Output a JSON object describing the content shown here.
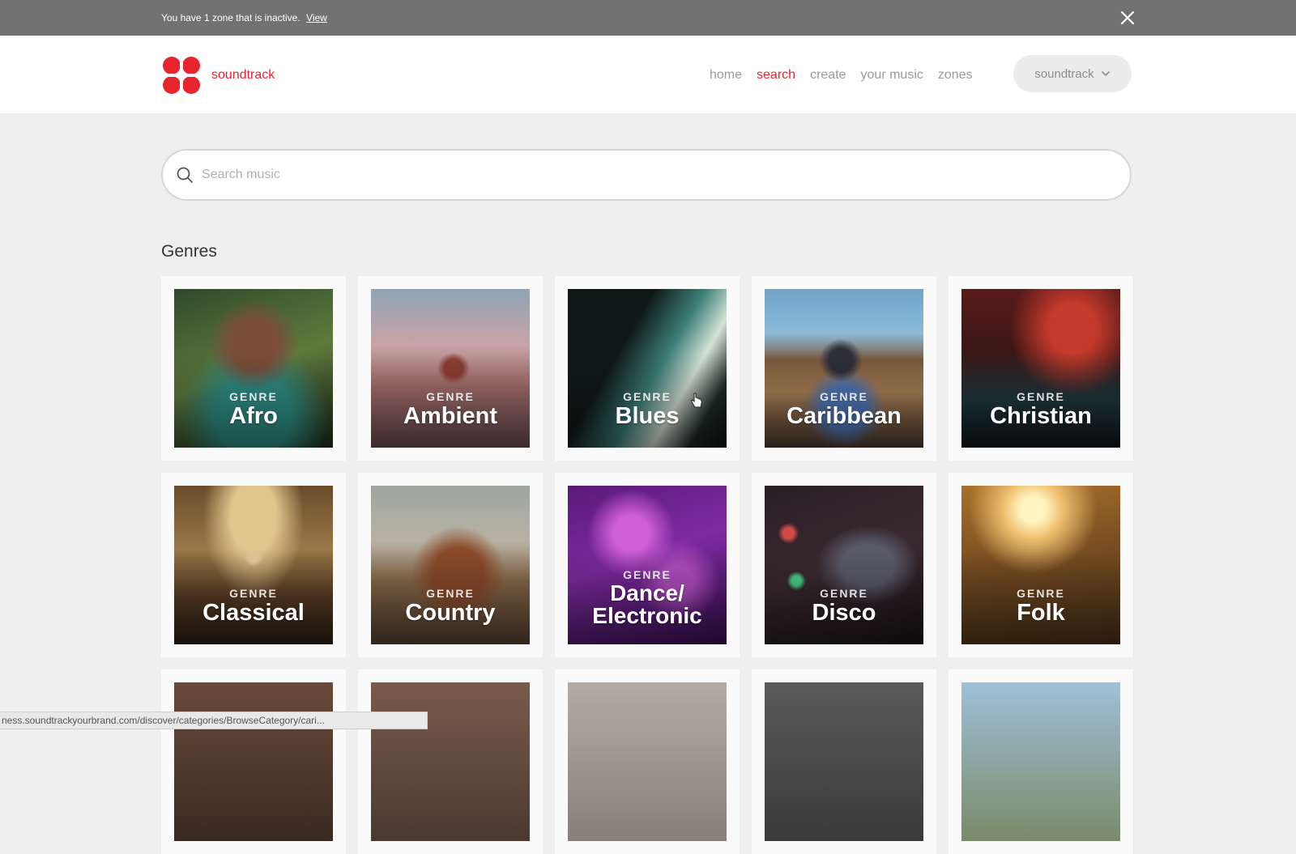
{
  "banner": {
    "message": "You have 1 zone that is inactive.",
    "link": "View"
  },
  "header": {
    "brand": "soundtrack",
    "nav": [
      {
        "label": "home",
        "active": false
      },
      {
        "label": "search",
        "active": true
      },
      {
        "label": "create",
        "active": false
      },
      {
        "label": "your music",
        "active": false
      },
      {
        "label": "zones",
        "active": false
      }
    ],
    "account": "soundtrack"
  },
  "search": {
    "placeholder": "Search music"
  },
  "genres": {
    "title": "Genres",
    "kicker": "GENRE",
    "items": [
      {
        "name": "Afro"
      },
      {
        "name": "Ambient"
      },
      {
        "name": "Blues"
      },
      {
        "name": "Caribbean"
      },
      {
        "name": "Christian"
      },
      {
        "name": "Classical"
      },
      {
        "name": "Country"
      },
      {
        "name": "Dance/ Electronic"
      },
      {
        "name": "Disco"
      },
      {
        "name": "Folk"
      }
    ]
  },
  "status_url": "ness.soundtrackyourbrand.com/discover/categories/BrowseCategory/cari...",
  "colors": {
    "brand": "#e8242f",
    "banner_bg": "#737272",
    "nav_inactive": "#9a9a9a"
  }
}
